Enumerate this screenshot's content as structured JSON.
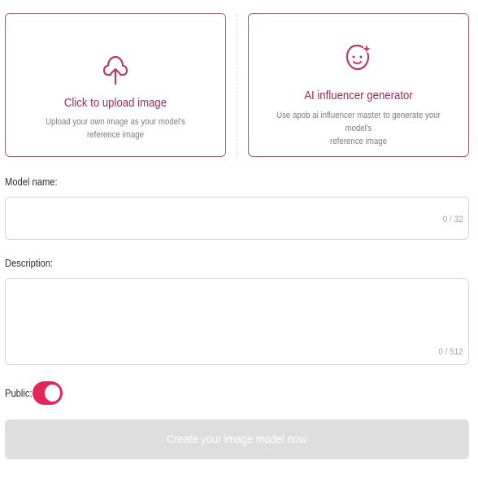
{
  "upload_card": {
    "title": "Click to upload image",
    "subtitle": "Upload your own image as your model's reference image",
    "icon": "cloud-upload-icon"
  },
  "ai_card": {
    "title": "AI influencer generator",
    "subtitle_line1": "Use apob ai influencer master to generate your model's",
    "subtitle_line2": "reference image",
    "icon": "sparkle-face-icon"
  },
  "form": {
    "model_name": {
      "label": "Model name:",
      "value": "",
      "counter": "0 / 32"
    },
    "description": {
      "label": "Description:",
      "value": "",
      "counter": "0 / 512"
    },
    "public": {
      "label": "Public:",
      "enabled": true
    }
  },
  "submit": {
    "label": "Create your image model now",
    "disabled": true
  },
  "colors": {
    "accent": "#9d2655",
    "toggle_on": "#e4245a",
    "card_border": "#a8607a",
    "button_disabled": "#dedede"
  }
}
